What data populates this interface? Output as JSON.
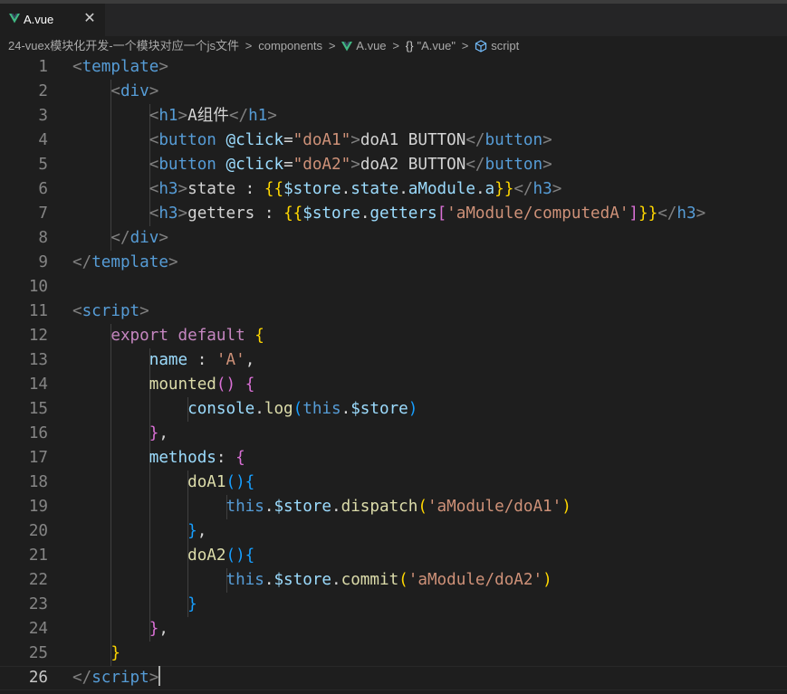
{
  "tab": {
    "label": "A.vue",
    "close": "✕",
    "icon": "vue-icon"
  },
  "breadcrumb": {
    "project": "24-vuex模块化开发-一个模块对应一个js文件",
    "folder": "components",
    "file": "A.vue",
    "object": "\"A.vue\"",
    "braces": "{}",
    "symbol": "script",
    "separator": ">"
  },
  "colors": {
    "punctuation": "#808080",
    "tag": "#569cd6",
    "attribute": "#9cdcfe",
    "string": "#ce9178",
    "keyword": "#c586c0",
    "function": "#dcdcaa",
    "bracket_gold": "#ffd700",
    "bracket_orchid": "#da70d6",
    "bracket_blue": "#179fff",
    "vue_green": "#41b883"
  },
  "editor": {
    "current_line": 26,
    "lines": [
      {
        "n": "1",
        "tokens": [
          [
            "pun",
            "<"
          ],
          [
            "tag",
            "template"
          ],
          [
            "pun",
            ">"
          ]
        ]
      },
      {
        "n": "2",
        "tokens": [
          [
            "txt",
            "    "
          ],
          [
            "pun",
            "<"
          ],
          [
            "tag",
            "div"
          ],
          [
            "pun",
            ">"
          ]
        ]
      },
      {
        "n": "3",
        "tokens": [
          [
            "txt",
            "        "
          ],
          [
            "pun",
            "<"
          ],
          [
            "tag",
            "h1"
          ],
          [
            "pun",
            ">"
          ],
          [
            "txt",
            "A组件"
          ],
          [
            "pun",
            "</"
          ],
          [
            "tag",
            "h1"
          ],
          [
            "pun",
            ">"
          ]
        ]
      },
      {
        "n": "4",
        "tokens": [
          [
            "txt",
            "        "
          ],
          [
            "pun",
            "<"
          ],
          [
            "tag",
            "button"
          ],
          [
            "txt",
            " "
          ],
          [
            "attr",
            "@click"
          ],
          [
            "txt",
            "="
          ],
          [
            "str",
            "\"doA1\""
          ],
          [
            "pun",
            ">"
          ],
          [
            "txt",
            "doA1 BUTTON"
          ],
          [
            "pun",
            "</"
          ],
          [
            "tag",
            "button"
          ],
          [
            "pun",
            ">"
          ]
        ]
      },
      {
        "n": "5",
        "tokens": [
          [
            "txt",
            "        "
          ],
          [
            "pun",
            "<"
          ],
          [
            "tag",
            "button"
          ],
          [
            "txt",
            " "
          ],
          [
            "attr",
            "@click"
          ],
          [
            "txt",
            "="
          ],
          [
            "str",
            "\"doA2\""
          ],
          [
            "pun",
            ">"
          ],
          [
            "txt",
            "doA2 BUTTON"
          ],
          [
            "pun",
            "</"
          ],
          [
            "tag",
            "button"
          ],
          [
            "pun",
            ">"
          ]
        ]
      },
      {
        "n": "6",
        "tokens": [
          [
            "txt",
            "        "
          ],
          [
            "pun",
            "<"
          ],
          [
            "tag",
            "h3"
          ],
          [
            "pun",
            ">"
          ],
          [
            "txt",
            "state : "
          ],
          [
            "b1",
            "{{"
          ],
          [
            "var",
            "$store"
          ],
          [
            "txt",
            "."
          ],
          [
            "var",
            "state"
          ],
          [
            "txt",
            "."
          ],
          [
            "var",
            "aModule"
          ],
          [
            "txt",
            "."
          ],
          [
            "var",
            "a"
          ],
          [
            "b1",
            "}}"
          ],
          [
            "pun",
            "</"
          ],
          [
            "tag",
            "h3"
          ],
          [
            "pun",
            ">"
          ]
        ]
      },
      {
        "n": "7",
        "tokens": [
          [
            "txt",
            "        "
          ],
          [
            "pun",
            "<"
          ],
          [
            "tag",
            "h3"
          ],
          [
            "pun",
            ">"
          ],
          [
            "txt",
            "getters : "
          ],
          [
            "b1",
            "{{"
          ],
          [
            "var",
            "$store"
          ],
          [
            "txt",
            "."
          ],
          [
            "var",
            "getters"
          ],
          [
            "b2",
            "["
          ],
          [
            "str",
            "'aModule/computedA'"
          ],
          [
            "b2",
            "]"
          ],
          [
            "b1",
            "}}"
          ],
          [
            "pun",
            "</"
          ],
          [
            "tag",
            "h3"
          ],
          [
            "pun",
            ">"
          ]
        ]
      },
      {
        "n": "8",
        "tokens": [
          [
            "txt",
            "    "
          ],
          [
            "pun",
            "</"
          ],
          [
            "tag",
            "div"
          ],
          [
            "pun",
            ">"
          ]
        ]
      },
      {
        "n": "9",
        "tokens": [
          [
            "pun",
            "</"
          ],
          [
            "tag",
            "template"
          ],
          [
            "pun",
            ">"
          ]
        ]
      },
      {
        "n": "10",
        "tokens": []
      },
      {
        "n": "11",
        "tokens": [
          [
            "pun",
            "<"
          ],
          [
            "tag",
            "script"
          ],
          [
            "pun",
            ">"
          ]
        ]
      },
      {
        "n": "12",
        "tokens": [
          [
            "txt",
            "    "
          ],
          [
            "kw",
            "export"
          ],
          [
            "txt",
            " "
          ],
          [
            "kw",
            "default"
          ],
          [
            "txt",
            " "
          ],
          [
            "b1",
            "{"
          ]
        ]
      },
      {
        "n": "13",
        "tokens": [
          [
            "txt",
            "        "
          ],
          [
            "var",
            "name"
          ],
          [
            "txt",
            " : "
          ],
          [
            "str",
            "'A'"
          ],
          [
            "txt",
            ","
          ]
        ]
      },
      {
        "n": "14",
        "tokens": [
          [
            "txt",
            "        "
          ],
          [
            "fn",
            "mounted"
          ],
          [
            "b2",
            "()"
          ],
          [
            "txt",
            " "
          ],
          [
            "b2",
            "{"
          ]
        ]
      },
      {
        "n": "15",
        "tokens": [
          [
            "txt",
            "            "
          ],
          [
            "var",
            "console"
          ],
          [
            "txt",
            "."
          ],
          [
            "fn",
            "log"
          ],
          [
            "b3",
            "("
          ],
          [
            "this",
            "this"
          ],
          [
            "txt",
            "."
          ],
          [
            "var",
            "$store"
          ],
          [
            "b3",
            ")"
          ]
        ]
      },
      {
        "n": "16",
        "tokens": [
          [
            "txt",
            "        "
          ],
          [
            "b2",
            "}"
          ],
          [
            "txt",
            ","
          ]
        ]
      },
      {
        "n": "17",
        "tokens": [
          [
            "txt",
            "        "
          ],
          [
            "var",
            "methods"
          ],
          [
            "txt",
            ": "
          ],
          [
            "b2",
            "{"
          ]
        ]
      },
      {
        "n": "18",
        "tokens": [
          [
            "txt",
            "            "
          ],
          [
            "fn",
            "doA1"
          ],
          [
            "b3",
            "()"
          ],
          [
            "b3",
            "{"
          ]
        ]
      },
      {
        "n": "19",
        "tokens": [
          [
            "txt",
            "                "
          ],
          [
            "this",
            "this"
          ],
          [
            "txt",
            "."
          ],
          [
            "var",
            "$store"
          ],
          [
            "txt",
            "."
          ],
          [
            "fn",
            "dispatch"
          ],
          [
            "b1",
            "("
          ],
          [
            "str",
            "'aModule/doA1'"
          ],
          [
            "b1",
            ")"
          ]
        ]
      },
      {
        "n": "20",
        "tokens": [
          [
            "txt",
            "            "
          ],
          [
            "b3",
            "}"
          ],
          [
            "txt",
            ","
          ]
        ]
      },
      {
        "n": "21",
        "tokens": [
          [
            "txt",
            "            "
          ],
          [
            "fn",
            "doA2"
          ],
          [
            "b3",
            "()"
          ],
          [
            "b3",
            "{"
          ]
        ]
      },
      {
        "n": "22",
        "tokens": [
          [
            "txt",
            "                "
          ],
          [
            "this",
            "this"
          ],
          [
            "txt",
            "."
          ],
          [
            "var",
            "$store"
          ],
          [
            "txt",
            "."
          ],
          [
            "fn",
            "commit"
          ],
          [
            "b1",
            "("
          ],
          [
            "str",
            "'aModule/doA2'"
          ],
          [
            "b1",
            ")"
          ]
        ]
      },
      {
        "n": "23",
        "tokens": [
          [
            "txt",
            "            "
          ],
          [
            "b3",
            "}"
          ]
        ]
      },
      {
        "n": "24",
        "tokens": [
          [
            "txt",
            "        "
          ],
          [
            "b2",
            "}"
          ],
          [
            "txt",
            ","
          ]
        ]
      },
      {
        "n": "25",
        "tokens": [
          [
            "txt",
            "    "
          ],
          [
            "b1",
            "}"
          ]
        ]
      },
      {
        "n": "26",
        "tokens": [
          [
            "pun",
            "</"
          ],
          [
            "tag",
            "script"
          ],
          [
            "pun",
            ">"
          ]
        ]
      }
    ]
  }
}
